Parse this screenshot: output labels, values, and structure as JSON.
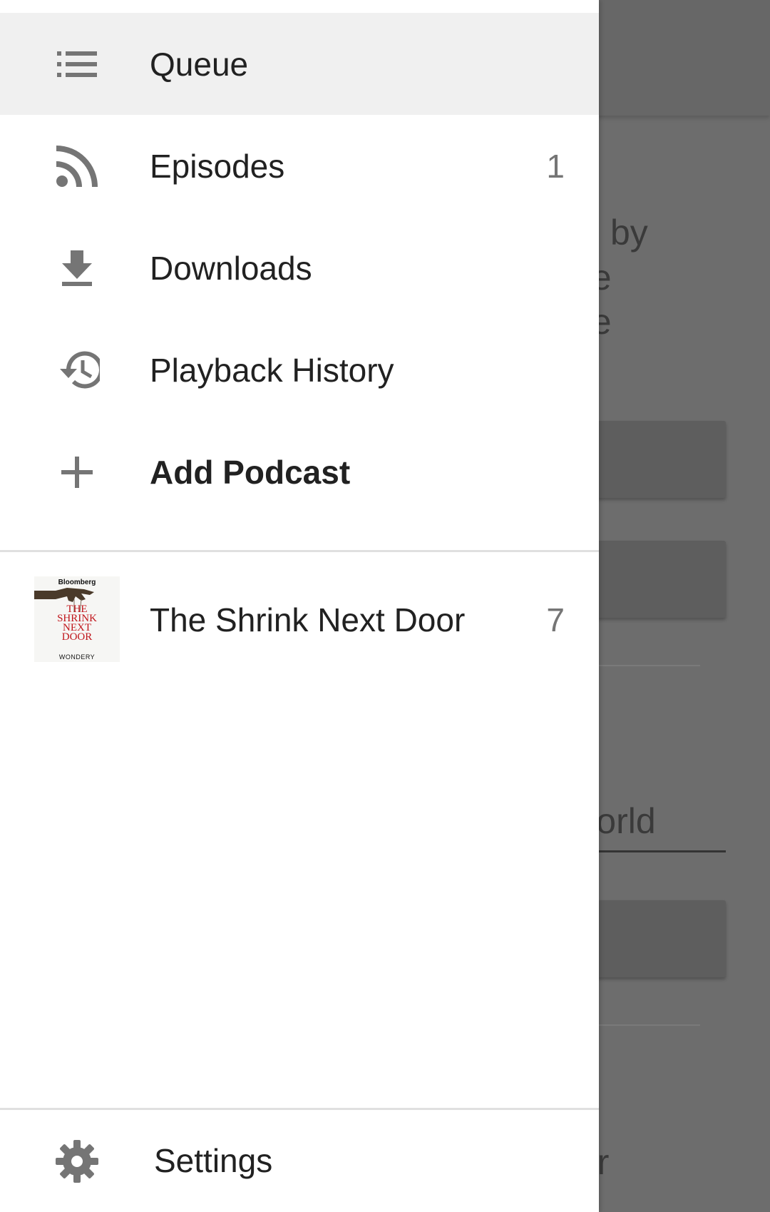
{
  "background": {
    "fragments": [
      "by",
      "ue",
      "he",
      "World",
      "ur"
    ]
  },
  "drawer": {
    "nav_items": [
      {
        "label": "Queue",
        "icon": "queue-list-icon",
        "count": "",
        "active": true
      },
      {
        "label": "Episodes",
        "icon": "rss-feed-icon",
        "count": "1"
      },
      {
        "label": "Downloads",
        "icon": "download-icon",
        "count": ""
      },
      {
        "label": "Playback History",
        "icon": "history-icon",
        "count": ""
      },
      {
        "label": "Add Podcast",
        "icon": "plus-icon",
        "count": ""
      }
    ],
    "podcasts": [
      {
        "title": "The Shrink Next Door",
        "count": "7",
        "art": {
          "brand": "Bloomberg",
          "title": "THE\nSHRINK\nNEXT\nDOOR",
          "footer": "WONDERY"
        }
      }
    ],
    "settings": {
      "label": "Settings",
      "icon": "gear-icon"
    }
  },
  "colors": {
    "active_bg": "#f0f0f0",
    "icon": "#757575",
    "text": "#212121",
    "scrim": "#6d6d6d"
  }
}
